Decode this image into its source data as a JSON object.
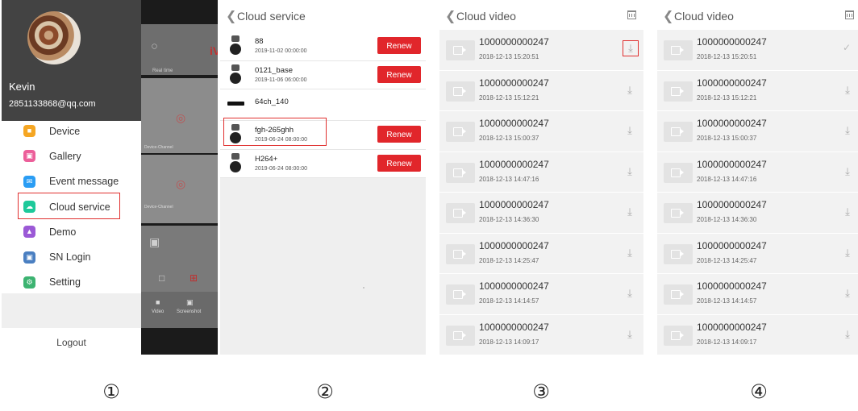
{
  "screen1": {
    "user_name": "Kevin",
    "user_email": "2851133868@qq.com",
    "menu": [
      {
        "label": "Device",
        "icon": "video-icon",
        "color": "#f5a623"
      },
      {
        "label": "Gallery",
        "icon": "image-icon",
        "color": "#ec5f9a"
      },
      {
        "label": "Event message",
        "icon": "mail-icon",
        "color": "#2a9df4"
      },
      {
        "label": "Cloud service",
        "icon": "cloud-icon",
        "color": "#1dc99a"
      },
      {
        "label": "Demo",
        "icon": "demo-icon",
        "color": "#9b59d6"
      },
      {
        "label": "SN Login",
        "icon": "scan-icon",
        "color": "#4a7fc1"
      },
      {
        "label": "Setting",
        "icon": "gear-icon",
        "color": "#3cb371"
      }
    ],
    "logout": "Logout",
    "behind": {
      "tab": "Real time",
      "video": "Video",
      "screenshot": "Screenshot",
      "channel1": "Device-Channel",
      "channel2": "Device-Channel",
      "brand": "iV"
    }
  },
  "screen2": {
    "title": "Cloud service",
    "renew_label": "Renew",
    "devices": [
      {
        "name": "88",
        "date": "2019-11-02 00:00:00",
        "renew": true,
        "type": "camera"
      },
      {
        "name": "0121_base",
        "date": "2019-11-06 06:00:00",
        "renew": true,
        "type": "camera"
      },
      {
        "name": "64ch_140",
        "date": "",
        "renew": false,
        "type": "nvr"
      },
      {
        "name": "fgh-265ghh",
        "date": "2019-06-24 08:00:00",
        "renew": true,
        "type": "camera"
      },
      {
        "name": "H264+",
        "date": "2019-06-24 08:00:00",
        "renew": true,
        "type": "camera"
      }
    ]
  },
  "screen3": {
    "title": "Cloud video",
    "videos": [
      {
        "id": "1000000000247",
        "date": "2018-12-13 15:20:51"
      },
      {
        "id": "1000000000247",
        "date": "2018-12-13 15:12:21"
      },
      {
        "id": "1000000000247",
        "date": "2018-12-13 15:00:37"
      },
      {
        "id": "1000000000247",
        "date": "2018-12-13 14:47:16"
      },
      {
        "id": "1000000000247",
        "date": "2018-12-13 14:36:30"
      },
      {
        "id": "1000000000247",
        "date": "2018-12-13 14:25:47"
      },
      {
        "id": "1000000000247",
        "date": "2018-12-13 14:14:57"
      },
      {
        "id": "1000000000247",
        "date": "2018-12-13 14:09:17"
      }
    ]
  },
  "screen4": {
    "title": "Cloud video",
    "videos": [
      {
        "id": "1000000000247",
        "date": "2018-12-13 15:20:51"
      },
      {
        "id": "1000000000247",
        "date": "2018-12-13 15:12:21"
      },
      {
        "id": "1000000000247",
        "date": "2018-12-13 15:00:37"
      },
      {
        "id": "1000000000247",
        "date": "2018-12-13 14:47:16"
      },
      {
        "id": "1000000000247",
        "date": "2018-12-13 14:36:30"
      },
      {
        "id": "1000000000247",
        "date": "2018-12-13 14:25:47"
      },
      {
        "id": "1000000000247",
        "date": "2018-12-13 14:14:57"
      },
      {
        "id": "1000000000247",
        "date": "2018-12-13 14:09:17"
      }
    ]
  },
  "steps": [
    "①",
    "②",
    "③",
    "④"
  ],
  "colors": {
    "accent_red": "#e1262b",
    "drawer_header": "#434343"
  }
}
